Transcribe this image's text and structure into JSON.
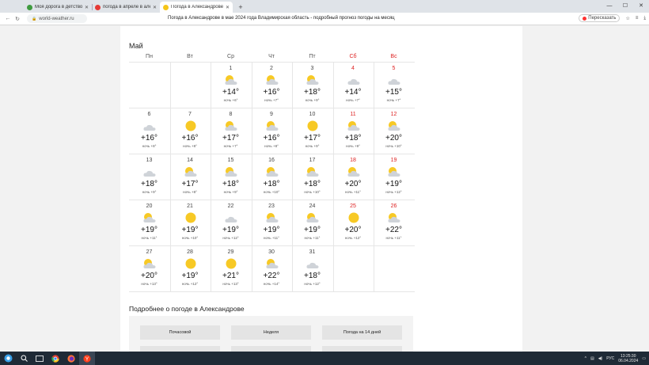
{
  "browser": {
    "tabs": [
      {
        "title": "Моя дорога в детство - О",
        "favicon_color": "#3f9b3f",
        "active": false
      },
      {
        "title": "погода в апреле в алекса",
        "favicon_color": "#e53935",
        "active": false
      },
      {
        "title": "Погода в Александрове в",
        "favicon_color": "#f5c518",
        "active": true
      }
    ],
    "url": "world-weather.ru",
    "page_title": "Погода в Александрове в мае 2024 года Владимирская область - подробный прогноз погоды на месяц",
    "retell_label": "Пересказать"
  },
  "calendar": {
    "month": "Май",
    "weekdays": [
      "Пн",
      "Вт",
      "Ср",
      "Чт",
      "Пт",
      "Сб",
      "Вс"
    ],
    "night_prefix": "ночь",
    "days": [
      {
        "d": "1",
        "icon": "partly-cloudy",
        "t": "+14°",
        "n": "+6°"
      },
      {
        "d": "2",
        "icon": "partly-cloudy",
        "t": "+16°",
        "n": "+7°"
      },
      {
        "d": "3",
        "icon": "partly-cloudy",
        "t": "+18°",
        "n": "+9°"
      },
      {
        "d": "4",
        "icon": "cloudy",
        "t": "+14°",
        "n": "+7°"
      },
      {
        "d": "5",
        "icon": "cloudy",
        "t": "+15°",
        "n": "+7°"
      },
      {
        "d": "6",
        "icon": "cloudy",
        "t": "+16°",
        "n": "+8°"
      },
      {
        "d": "7",
        "icon": "sunny",
        "t": "+16°",
        "n": "+8°"
      },
      {
        "d": "8",
        "icon": "partly-cloudy",
        "t": "+17°",
        "n": "+7°"
      },
      {
        "d": "9",
        "icon": "partly-cloudy",
        "t": "+16°",
        "n": "+8°"
      },
      {
        "d": "10",
        "icon": "sunny",
        "t": "+17°",
        "n": "+9°"
      },
      {
        "d": "11",
        "icon": "partly-cloudy",
        "t": "+18°",
        "n": "+9°"
      },
      {
        "d": "12",
        "icon": "partly-cloudy",
        "t": "+20°",
        "n": "+10°"
      },
      {
        "d": "13",
        "icon": "cloudy",
        "t": "+18°",
        "n": "+9°"
      },
      {
        "d": "14",
        "icon": "partly-cloudy",
        "t": "+17°",
        "n": "+8°"
      },
      {
        "d": "15",
        "icon": "partly-cloudy",
        "t": "+18°",
        "n": "+9°"
      },
      {
        "d": "16",
        "icon": "partly-cloudy",
        "t": "+18°",
        "n": "+10°"
      },
      {
        "d": "17",
        "icon": "partly-cloudy",
        "t": "+18°",
        "n": "+10°"
      },
      {
        "d": "18",
        "icon": "partly-cloudy",
        "t": "+20°",
        "n": "+11°"
      },
      {
        "d": "19",
        "icon": "partly-cloudy",
        "t": "+19°",
        "n": "+12°"
      },
      {
        "d": "20",
        "icon": "partly-cloudy",
        "t": "+19°",
        "n": "+11°"
      },
      {
        "d": "21",
        "icon": "sunny",
        "t": "+19°",
        "n": "+10°"
      },
      {
        "d": "22",
        "icon": "cloudy",
        "t": "+19°",
        "n": "+12°"
      },
      {
        "d": "23",
        "icon": "partly-cloudy",
        "t": "+19°",
        "n": "+11°"
      },
      {
        "d": "24",
        "icon": "partly-cloudy",
        "t": "+19°",
        "n": "+11°"
      },
      {
        "d": "25",
        "icon": "sunny",
        "t": "+20°",
        "n": "+12°"
      },
      {
        "d": "26",
        "icon": "partly-cloudy",
        "t": "+22°",
        "n": "+11°"
      },
      {
        "d": "27",
        "icon": "partly-cloudy",
        "t": "+20°",
        "n": "+13°"
      },
      {
        "d": "28",
        "icon": "sunny",
        "t": "+19°",
        "n": "+12°"
      },
      {
        "d": "29",
        "icon": "sunny",
        "t": "+21°",
        "n": "+13°"
      },
      {
        "d": "30",
        "icon": "partly-cloudy",
        "t": "+22°",
        "n": "+14°"
      },
      {
        "d": "31",
        "icon": "cloudy",
        "t": "+18°",
        "n": "+12°"
      }
    ],
    "first_weekday_index": 2
  },
  "more": {
    "title": "Подробнее о погоде в Александрове",
    "buttons": [
      "Почасовой",
      "Неделя",
      "Погода на 14 дней"
    ]
  },
  "taskbar": {
    "lang": "РУС",
    "time": "13:25:30",
    "date": "06.04.2024"
  },
  "colors": {
    "weekend": "#dd2222",
    "sun": "#f7c925",
    "cloud": "#cfd3d8"
  }
}
